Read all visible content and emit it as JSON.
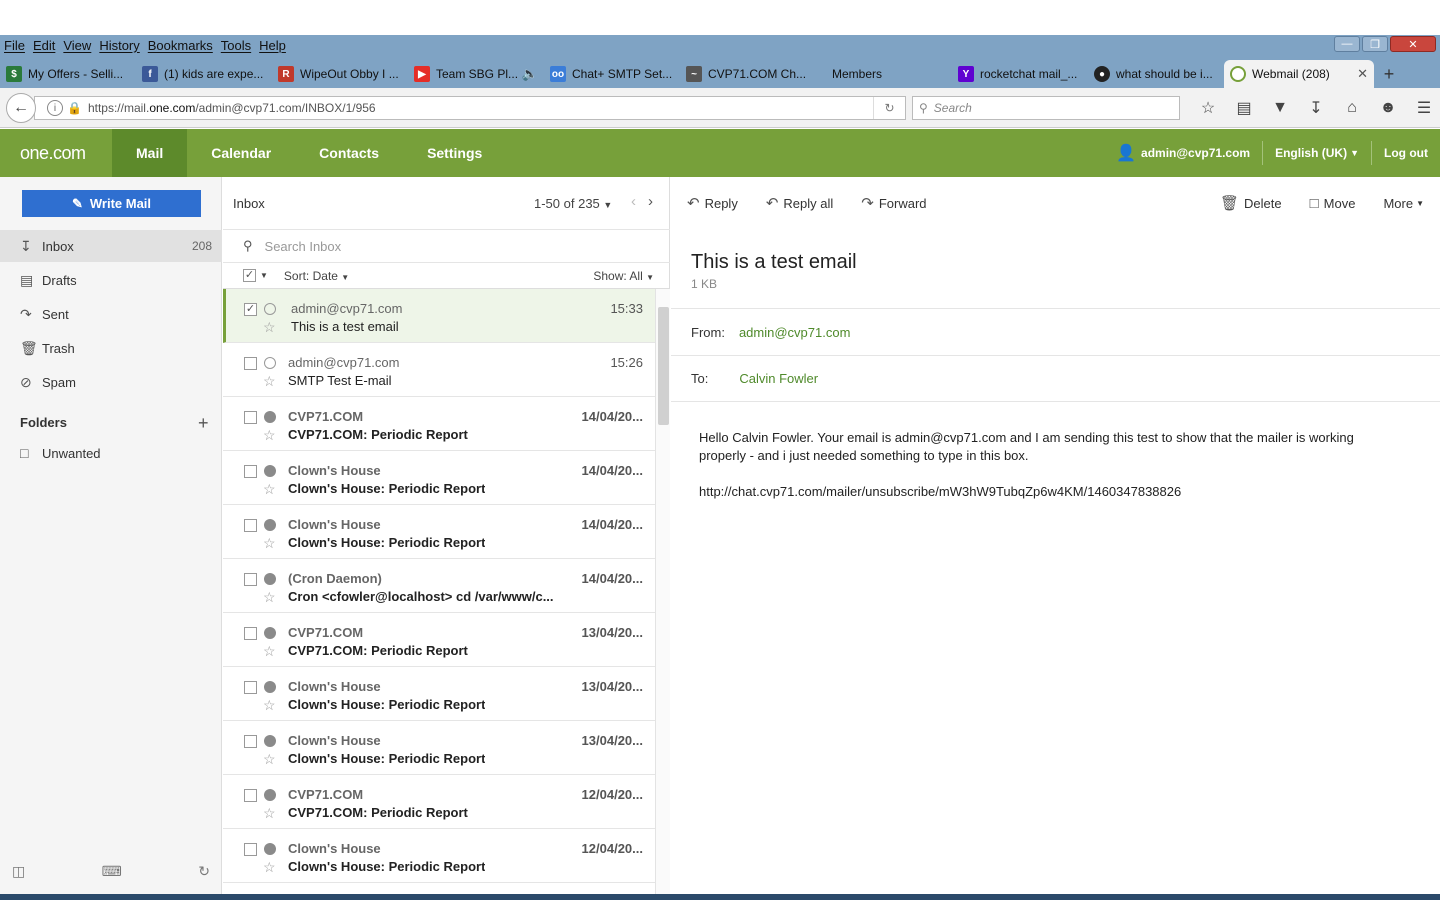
{
  "browser": {
    "menu": [
      "File",
      "Edit",
      "View",
      "History",
      "Bookmarks",
      "Tools",
      "Help"
    ],
    "tabs": [
      {
        "label": "My Offers - Selli...",
        "fav": "#2a7a3a"
      },
      {
        "label": "(1) kids are expe...",
        "fav": "#3b5998"
      },
      {
        "label": "WipeOut Obby I ...",
        "fav": "#c0392b"
      },
      {
        "label": "Team SBG Pl...",
        "fav": "#e52d27"
      },
      {
        "label": "Chat+ SMTP Set...",
        "fav": "#3b7dd8"
      },
      {
        "label": "CVP71.COM Ch...",
        "fav": "#555555"
      },
      {
        "label": "Members",
        "fav": ""
      },
      {
        "label": "rocketchat mail_...",
        "fav": "#5f01d1"
      },
      {
        "label": "what should be i...",
        "fav": "#222222"
      },
      {
        "label": "Webmail (208)",
        "fav": "#77a03a"
      }
    ],
    "url_prefix": "https://mail.",
    "url_domain": "one.com",
    "url_path": "/admin@cvp71.com/INBOX/1/956",
    "search_placeholder": "Search"
  },
  "app": {
    "logo": "one.com",
    "nav": [
      "Mail",
      "Calendar",
      "Contacts",
      "Settings"
    ],
    "user": "admin@cvp71.com",
    "language": "English (UK)",
    "logout": "Log out",
    "accent": "#77a03a"
  },
  "sidebar": {
    "write_mail": "Write Mail",
    "folders": [
      {
        "label": "Inbox",
        "count": "208",
        "icon": "inbox-icon"
      },
      {
        "label": "Drafts",
        "count": "",
        "icon": "drafts-icon"
      },
      {
        "label": "Sent",
        "count": "",
        "icon": "sent-icon"
      },
      {
        "label": "Trash",
        "count": "",
        "icon": "trash-icon"
      },
      {
        "label": "Spam",
        "count": "",
        "icon": "spam-icon"
      }
    ],
    "folders_header": "Folders",
    "custom_folders": [
      "Unwanted"
    ]
  },
  "list": {
    "title": "Inbox",
    "paging": "1-50 of 235",
    "search_placeholder": "Search Inbox",
    "sort": "Sort: Date",
    "show": "Show: All",
    "messages": [
      {
        "from": "admin@cvp71.com",
        "subject": "This is a test email",
        "time": "15:33",
        "unread": false,
        "checked": true
      },
      {
        "from": "admin@cvp71.com",
        "subject": "SMTP Test E-mail",
        "time": "15:26",
        "unread": false,
        "checked": false
      },
      {
        "from": "CVP71.COM",
        "subject": "CVP71.COM: Periodic Report",
        "time": "14/04/20...",
        "unread": true,
        "checked": false
      },
      {
        "from": "Clown's House",
        "subject": "Clown's House: Periodic Report",
        "time": "14/04/20...",
        "unread": true,
        "checked": false
      },
      {
        "from": "Clown's House",
        "subject": "Clown's House: Periodic Report",
        "time": "14/04/20...",
        "unread": true,
        "checked": false
      },
      {
        "from": "(Cron Daemon)",
        "subject": "Cron <cfowler@localhost> cd /var/www/c...",
        "time": "14/04/20...",
        "unread": true,
        "checked": false
      },
      {
        "from": "CVP71.COM",
        "subject": "CVP71.COM: Periodic Report",
        "time": "13/04/20...",
        "unread": true,
        "checked": false
      },
      {
        "from": "Clown's House",
        "subject": "Clown's House: Periodic Report",
        "time": "13/04/20...",
        "unread": true,
        "checked": false
      },
      {
        "from": "Clown's House",
        "subject": "Clown's House: Periodic Report",
        "time": "13/04/20...",
        "unread": true,
        "checked": false
      },
      {
        "from": "CVP71.COM",
        "subject": "CVP71.COM: Periodic Report",
        "time": "12/04/20...",
        "unread": true,
        "checked": false
      },
      {
        "from": "Clown's House",
        "subject": "Clown's House: Periodic Report",
        "time": "12/04/20...",
        "unread": true,
        "checked": false
      }
    ]
  },
  "reader": {
    "toolbar": {
      "reply": "Reply",
      "reply_all": "Reply all",
      "forward": "Forward",
      "delete": "Delete",
      "move": "Move",
      "more": "More"
    },
    "subject": "This is a test email",
    "size": "1 KB",
    "from_label": "From:",
    "from": "admin@cvp71.com",
    "to_label": "To:",
    "to": "Calvin Fowler",
    "body_line1": "Hello Calvin Fowler. Your email is admin@cvp71.com and I am sending this test to show that the mailer is working properly - and i just needed something to type in this box.",
    "body_link": "http://chat.cvp71.com/mailer/unsubscribe/mW3hW9TubqZp6w4KM/1460347838826"
  }
}
